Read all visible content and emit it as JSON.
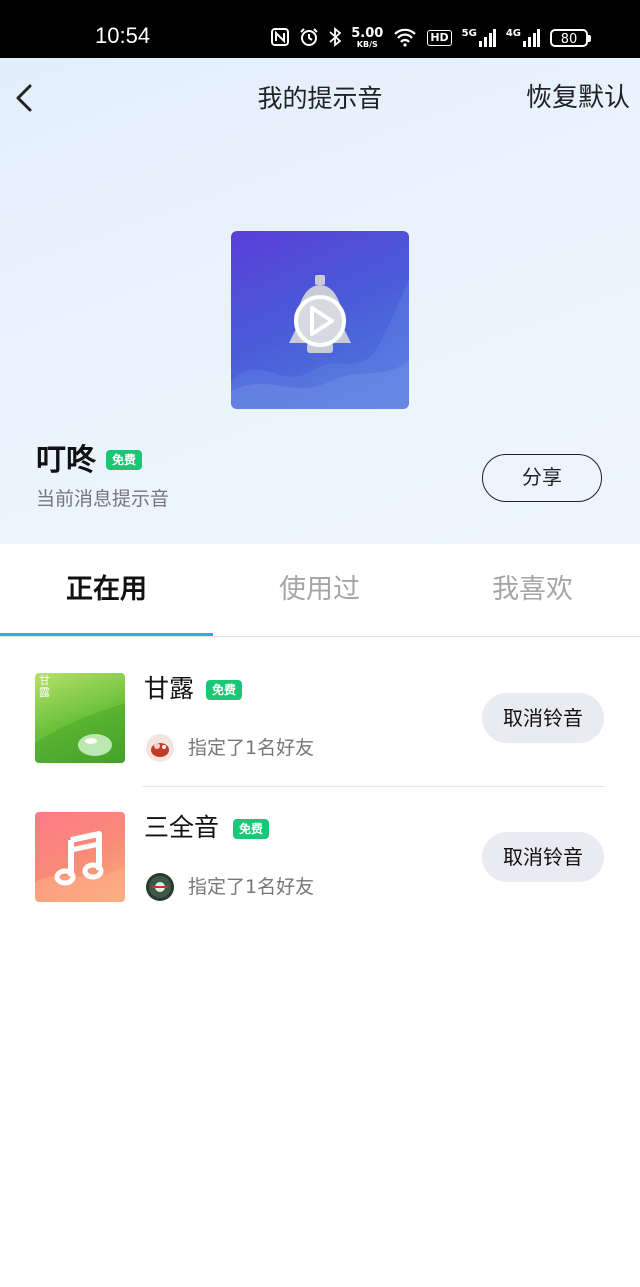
{
  "status_bar": {
    "time": "10:54",
    "net_speed_value": "5.00",
    "net_speed_unit": "KB/S",
    "hd_label": "HD",
    "signal1_label": "5G",
    "signal2_label": "4G",
    "battery": "80"
  },
  "header": {
    "title": "我的提示音",
    "restore_label": "恢复默认"
  },
  "current_tone": {
    "name": "叮咚",
    "tag": "免费",
    "subtitle": "当前消息提示音",
    "share_label": "分享"
  },
  "tabs": [
    {
      "label": "正在用",
      "active": true
    },
    {
      "label": "使用过",
      "active": false
    },
    {
      "label": "我喜欢",
      "active": false
    }
  ],
  "tones": [
    {
      "name": "甘露",
      "tag": "免费",
      "thumb_text": "甘露",
      "friends_text": "指定了1名好友",
      "action_label": "取消铃音"
    },
    {
      "name": "三全音",
      "tag": "免费",
      "friends_text": "指定了1名好友",
      "action_label": "取消铃音"
    }
  ],
  "colors": {
    "accent_indicator": "#26b0e8",
    "free_tag": "#19c774",
    "cover_purple": "#5a3ed8"
  }
}
